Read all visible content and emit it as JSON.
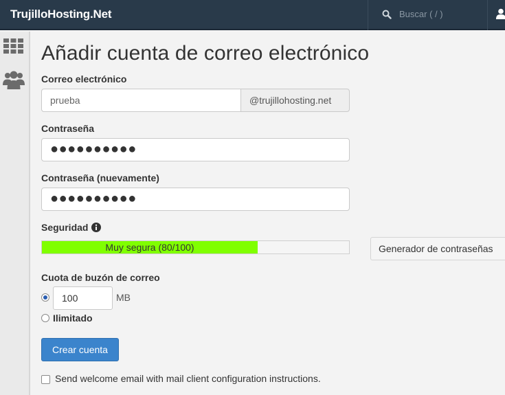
{
  "header": {
    "brand": "TrujilloHosting.Net",
    "search_placeholder": "Buscar ( / )",
    "icons": [
      "search-icon",
      "user-icon"
    ]
  },
  "sidebar": {
    "icons": [
      "grid-icon",
      "users-icon"
    ]
  },
  "page": {
    "title": "Añadir cuenta de correo electrónico"
  },
  "form": {
    "email_label": "Correo electrónico",
    "email_value": "prueba",
    "email_domain": "@trujillohosting.net",
    "password_label": "Contraseña",
    "password_value": "●●●●●●●●●●",
    "password_confirm_label": "Contraseña (nuevamente)",
    "password_confirm_value": "●●●●●●●●●●",
    "security_label": "Seguridad",
    "strength_text": "Muy segura (80/100)",
    "strength_value": 80,
    "strength_color": "#80ff00",
    "generator_label": "Generador de contraseñas",
    "quota_label": "Cuota de buzón de correo",
    "quota_value": "100",
    "quota_unit": "MB",
    "quota_selected": "limited",
    "unlimited_label": "Ilimitado",
    "create_button": "Crear cuenta",
    "welcome_label": "Send welcome email with mail client configuration instructions.",
    "welcome_checked": false
  },
  "colors": {
    "header_bg": "#293a4a",
    "primary_button": "#3b84cc"
  }
}
